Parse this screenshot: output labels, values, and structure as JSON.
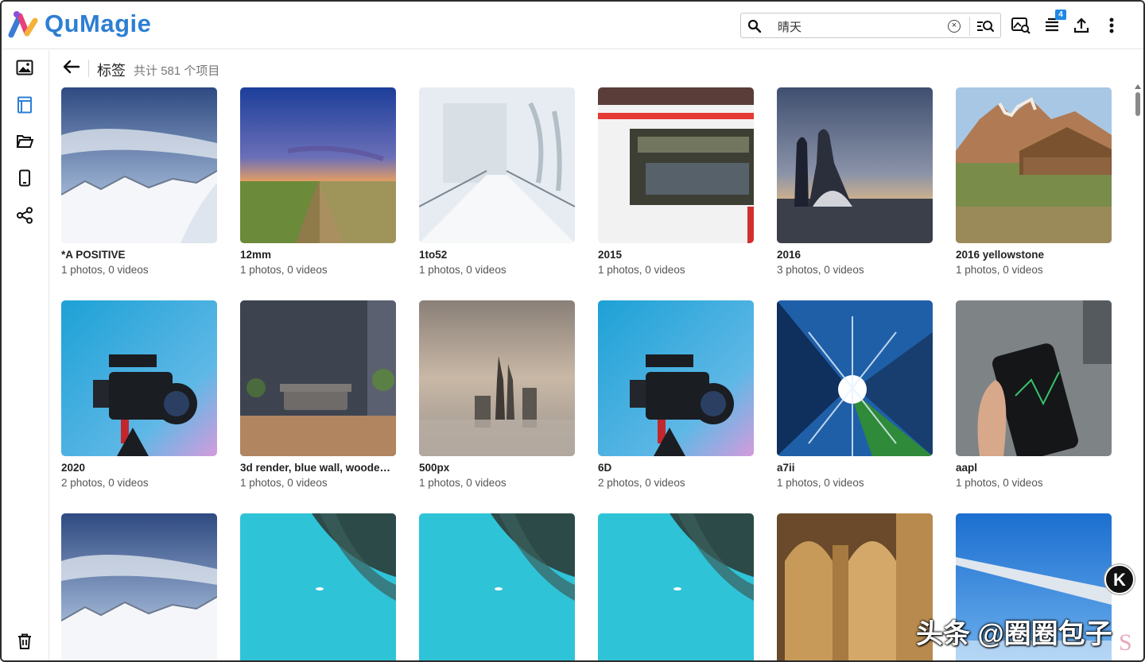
{
  "app": {
    "name": "QuMagie"
  },
  "search": {
    "value": "晴天"
  },
  "toolbar": {
    "notification_count": "4"
  },
  "sidebar": {
    "items": [
      "photos",
      "timeline",
      "folders",
      "devices",
      "shared"
    ]
  },
  "header": {
    "title": "标签",
    "count_prefix": "共计",
    "count": "581",
    "count_suffix": "个项目"
  },
  "tiles": [
    {
      "name": "*A POSITIVE",
      "sub": "1 photos, 0 videos"
    },
    {
      "name": "12mm",
      "sub": "1 photos, 0 videos"
    },
    {
      "name": "1to52",
      "sub": "1 photos, 0 videos"
    },
    {
      "name": "2015",
      "sub": "1 photos, 0 videos"
    },
    {
      "name": "2016",
      "sub": "3 photos, 0 videos"
    },
    {
      "name": "2016 yellowstone",
      "sub": "1 photos, 0 videos"
    },
    {
      "name": "2020",
      "sub": "2 photos, 0 videos"
    },
    {
      "name": "3d render, blue wall, wooden, …",
      "sub": "1 photos, 0 videos"
    },
    {
      "name": "500px",
      "sub": "1 photos, 0 videos"
    },
    {
      "name": "6D",
      "sub": "2 photos, 0 videos"
    },
    {
      "name": "a7ii",
      "sub": "1 photos, 0 videos"
    },
    {
      "name": "aapl",
      "sub": "1 photos, 0 videos"
    }
  ],
  "overlay": {
    "k_button": "K",
    "watermark": "头条 @圈圈包子",
    "watermark_s": "S"
  }
}
